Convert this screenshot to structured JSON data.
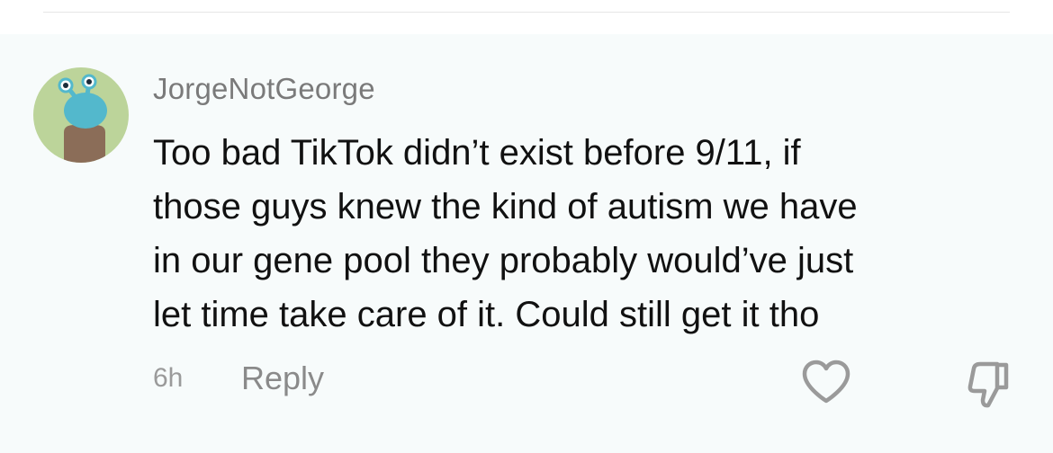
{
  "comment": {
    "username": "JorgeNotGeorge",
    "text_lines": [
      "Too bad TikTok didn’t exist before 9/11, if",
      "those guys knew the kind of autism we have",
      "in our gene pool they probably would’ve just",
      "let time take care of it. Could still get it tho"
    ],
    "time": "6h",
    "reply_label": "Reply",
    "avatar_icon": "cartoon-character-avatar",
    "like_icon": "heart-outline-icon",
    "dislike_icon": "thumbs-down-outline-icon"
  },
  "colors": {
    "card_background": "#f7fbfb",
    "username": "#7a7a7a",
    "body_text": "#111111",
    "meta_text": "#9a9a9a",
    "avatar_background": "#bcd49a"
  }
}
